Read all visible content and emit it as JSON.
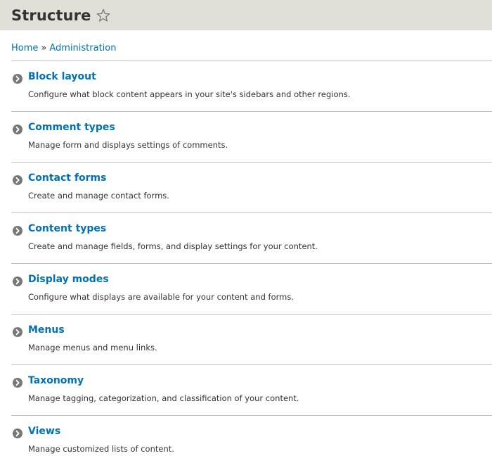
{
  "header": {
    "title": "Structure",
    "shortcut_icon": "star-outline-icon"
  },
  "breadcrumb": {
    "items": [
      "Home",
      "Administration"
    ],
    "separator": "»"
  },
  "admin_items": [
    {
      "title": "Block layout",
      "description": "Configure what block content appears in your site's sidebars and other regions.",
      "icon": "chevron-right-circle-icon"
    },
    {
      "title": "Comment types",
      "description": "Manage form and displays settings of comments.",
      "icon": "chevron-right-circle-icon"
    },
    {
      "title": "Contact forms",
      "description": "Create and manage contact forms.",
      "icon": "chevron-right-circle-icon"
    },
    {
      "title": "Content types",
      "description": "Create and manage fields, forms, and display settings for your content.",
      "icon": "chevron-right-circle-icon"
    },
    {
      "title": "Display modes",
      "description": "Configure what displays are available for your content and forms.",
      "icon": "chevron-right-circle-icon"
    },
    {
      "title": "Menus",
      "description": "Manage menus and menu links.",
      "icon": "chevron-right-circle-icon"
    },
    {
      "title": "Taxonomy",
      "description": "Manage tagging, categorization, and classification of your content.",
      "icon": "chevron-right-circle-icon"
    },
    {
      "title": "Views",
      "description": "Manage customized lists of content.",
      "icon": "chevron-right-circle-icon"
    }
  ],
  "colors": {
    "header_bg": "#e0e0d8",
    "link": "#0071b3",
    "text": "#333333",
    "divider": "#bfbfba",
    "icon": "#777777"
  }
}
